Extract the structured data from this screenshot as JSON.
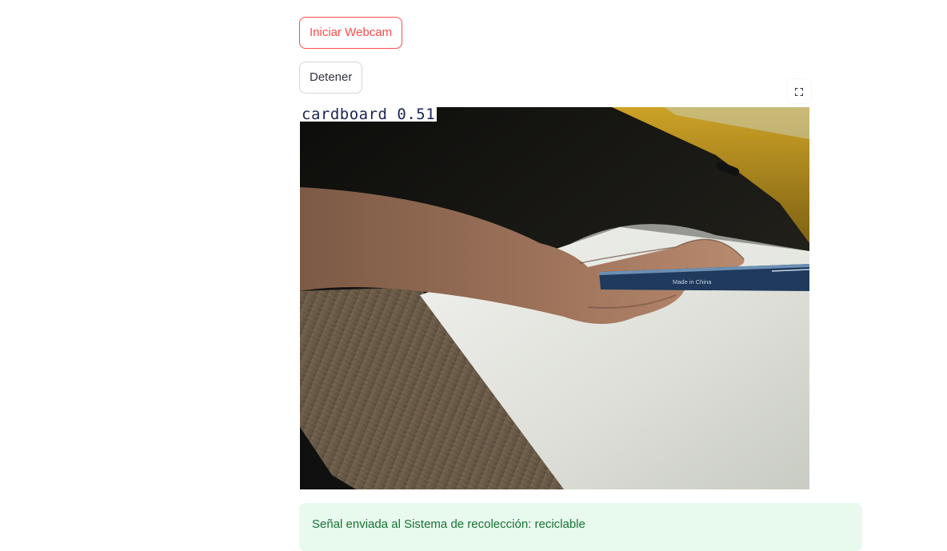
{
  "controls": {
    "start_label": "Iniciar Webcam",
    "stop_label": "Detener"
  },
  "webcam": {
    "detection_label": "cardboard 0.51",
    "box_text": "Made in China"
  },
  "status": {
    "message": "Señal enviada al Sistema de recolección: reciclable"
  },
  "colors": {
    "accent": "#ff4b4b",
    "success_text": "#177233",
    "detection_box": "#1c2453"
  },
  "icons": {
    "fullscreen": "fullscreen-icon"
  }
}
